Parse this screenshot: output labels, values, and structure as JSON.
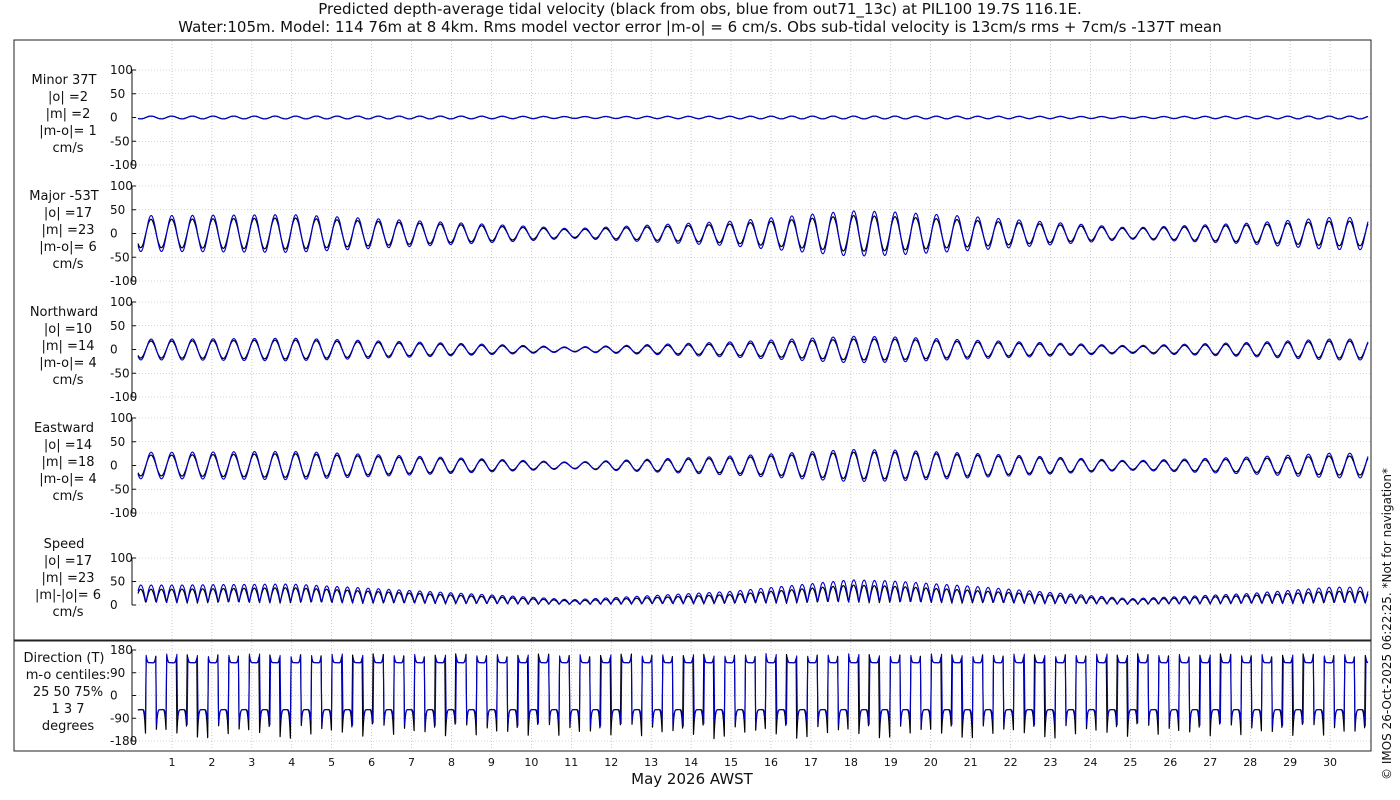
{
  "title_line1": "Predicted depth-average tidal velocity (black from obs, blue from out71_13c) at PIL100 19.7S 116.1E.",
  "title_line2": "Water:105m. Model: 114 76m at 8 4km. Rms model vector error |m-o| = 6 cm/s. Obs sub-tidal velocity is 13cm/s rms + 7cm/s -137T mean",
  "xlabel": "May 2026 AWST",
  "copyright": "© IMOS 26-Oct-2025 06:22:25. *Not for navigation*",
  "colors": {
    "obs": "#000000",
    "model": "#0000cc",
    "grid": "#aaaaaa"
  },
  "chart_data": {
    "type": "line",
    "x_unit": "day of May 2026 (AWST)",
    "xlim": [
      0.1,
      31.0
    ],
    "x_ticks": [
      1,
      2,
      3,
      4,
      5,
      6,
      7,
      8,
      9,
      10,
      11,
      12,
      13,
      14,
      15,
      16,
      17,
      18,
      19,
      20,
      21,
      22,
      23,
      24,
      25,
      26,
      27,
      28,
      29,
      30
    ],
    "panels": [
      {
        "id": "minor",
        "label_lines": [
          "Minor 37T",
          "|o| =2",
          "|m| =2",
          "|m-o|= 1",
          "cm/s"
        ],
        "ylim": [
          -100,
          100
        ],
        "y_ticks": [
          -100,
          -50,
          0,
          50,
          100
        ],
        "amplitude_envelope": {
          "days": [
            1,
            8,
            11,
            17,
            19,
            25,
            30
          ],
          "obs": [
            3,
            3,
            2,
            3,
            3,
            2,
            3
          ],
          "model": [
            3,
            3,
            2,
            3,
            3,
            2,
            3
          ]
        },
        "mode": "signed"
      },
      {
        "id": "major",
        "label_lines": [
          "Major -53T",
          "|o| =17",
          "|m| =23",
          "|m-o|= 6",
          "cm/s"
        ],
        "ylim": [
          -100,
          100
        ],
        "y_ticks": [
          -100,
          -50,
          0,
          50,
          100
        ],
        "amplitude_envelope": {
          "days": [
            1,
            4,
            10,
            11,
            15,
            18,
            19,
            21,
            25,
            28,
            30
          ],
          "obs": [
            30,
            33,
            12,
            8,
            20,
            38,
            36,
            28,
            10,
            18,
            26
          ],
          "model": [
            38,
            40,
            15,
            10,
            26,
            48,
            46,
            36,
            12,
            22,
            34
          ]
        },
        "mode": "signed"
      },
      {
        "id": "north",
        "label_lines": [
          "Northward",
          "|o| =10",
          "|m| =14",
          "|m-o|= 4",
          "cm/s"
        ],
        "ylim": [
          -100,
          100
        ],
        "y_ticks": [
          -100,
          -50,
          0,
          50,
          100
        ],
        "amplitude_envelope": {
          "days": [
            1,
            4,
            10,
            11,
            15,
            18,
            19,
            21,
            25,
            28,
            30
          ],
          "obs": [
            18,
            20,
            6,
            4,
            12,
            22,
            22,
            16,
            6,
            12,
            18
          ],
          "model": [
            22,
            24,
            8,
            5,
            16,
            28,
            27,
            20,
            8,
            15,
            22
          ]
        },
        "mode": "signed"
      },
      {
        "id": "east",
        "label_lines": [
          "Eastward",
          "|o| =14",
          "|m| =18",
          "|m-o|= 4",
          "cm/s"
        ],
        "ylim": [
          -100,
          100
        ],
        "y_ticks": [
          -100,
          -50,
          0,
          50,
          100
        ],
        "amplitude_envelope": {
          "days": [
            1,
            4,
            10,
            11,
            15,
            18,
            19,
            21,
            25,
            28,
            30
          ],
          "obs": [
            22,
            25,
            8,
            6,
            16,
            28,
            28,
            22,
            8,
            14,
            20
          ],
          "model": [
            28,
            30,
            10,
            7,
            20,
            34,
            33,
            26,
            10,
            18,
            26
          ]
        },
        "mode": "signed"
      },
      {
        "id": "speed",
        "label_lines": [
          "Speed",
          "|o| =17",
          "|m| =23",
          "|m|-|o|= 6",
          "cm/s"
        ],
        "ylim": [
          0,
          100
        ],
        "y_ticks": [
          0,
          50,
          100
        ],
        "amplitude_envelope": {
          "days": [
            1,
            4,
            10,
            11,
            15,
            18,
            19,
            21,
            25,
            28,
            30
          ],
          "obs": [
            30,
            33,
            12,
            8,
            20,
            38,
            36,
            28,
            10,
            18,
            26
          ],
          "model": [
            38,
            40,
            15,
            10,
            26,
            48,
            46,
            36,
            12,
            22,
            34
          ]
        },
        "mode": "speed"
      },
      {
        "id": "direction",
        "label_lines": [
          "Direction (T)",
          "m-o centiles:",
          "25  50  75%",
          "1   3   7",
          "degrees"
        ],
        "ylim": [
          -180,
          180
        ],
        "y_ticks": [
          -180,
          -90,
          0,
          90,
          180
        ],
        "mode": "direction",
        "direction_levels": {
          "flood": 127,
          "ebb": -53,
          "peak": 165,
          "trough": -170
        }
      }
    ],
    "tidal_period_days": 0.5175,
    "phase_days": 0.35
  }
}
